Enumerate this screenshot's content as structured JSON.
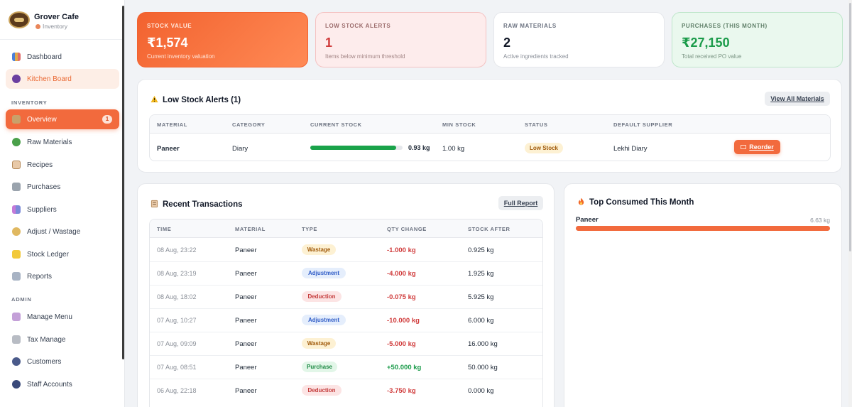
{
  "brand": {
    "name": "Grover Cafe",
    "subtitle": "Inventory"
  },
  "nav": {
    "dashboard": "Dashboard",
    "kitchen_board": "Kitchen Board",
    "section_inventory": "INVENTORY",
    "overview": "Overview",
    "overview_badge": "1",
    "raw_materials": "Raw Materials",
    "recipes": "Recipes",
    "purchases": "Purchases",
    "suppliers": "Suppliers",
    "adjust_wastage": "Adjust / Wastage",
    "stock_ledger": "Stock Ledger",
    "reports": "Reports",
    "section_admin": "ADMIN",
    "manage_menu": "Manage Menu",
    "tax_manage": "Tax Manage",
    "customers": "Customers",
    "staff_accounts": "Staff Accounts"
  },
  "stats": {
    "stock_value": {
      "title": "STOCK VALUE",
      "value": "₹1,574",
      "sub": "Current inventory valuation"
    },
    "low_stock": {
      "title": "LOW STOCK ALERTS",
      "value": "1",
      "sub": "Items below minimum threshold"
    },
    "raw_materials": {
      "title": "RAW MATERIALS",
      "value": "2",
      "sub": "Active ingredients tracked"
    },
    "purchases": {
      "title": "PURCHASES (THIS MONTH)",
      "value": "₹27,150",
      "sub": "Total received PO value"
    }
  },
  "low_stock_panel": {
    "title": "Low Stock Alerts (1)",
    "view_all": "View All Materials",
    "headers": [
      "MATERIAL",
      "CATEGORY",
      "CURRENT STOCK",
      "MIN STOCK",
      "STATUS",
      "DEFAULT SUPPLIER"
    ],
    "row": {
      "material": "Paneer",
      "category": "Diary",
      "current_stock": "0.93 kg",
      "stock_level": 0.93,
      "min_stock": "1.00 kg",
      "status": "Low Stock",
      "supplier": "Lekhi Diary",
      "action": "Reorder"
    }
  },
  "transactions": {
    "title": "Recent Transactions",
    "full_report": "Full Report",
    "headers": [
      "TIME",
      "MATERIAL",
      "TYPE",
      "QTY CHANGE",
      "STOCK AFTER"
    ],
    "rows": [
      {
        "time": "08 Aug, 23:22",
        "material": "Paneer",
        "type": "Wastage",
        "qty": "-1.000 kg",
        "after": "0.925 kg"
      },
      {
        "time": "08 Aug, 23:19",
        "material": "Paneer",
        "type": "Adjustment",
        "qty": "-4.000 kg",
        "after": "1.925 kg"
      },
      {
        "time": "08 Aug, 18:02",
        "material": "Paneer",
        "type": "Deduction",
        "qty": "-0.075 kg",
        "after": "5.925 kg"
      },
      {
        "time": "07 Aug, 10:27",
        "material": "Paneer",
        "type": "Adjustment",
        "qty": "-10.000 kg",
        "after": "6.000 kg"
      },
      {
        "time": "07 Aug, 09:09",
        "material": "Paneer",
        "type": "Wastage",
        "qty": "-5.000 kg",
        "after": "16.000 kg"
      },
      {
        "time": "07 Aug, 08:51",
        "material": "Paneer",
        "type": "Purchase",
        "qty": "+50.000 kg",
        "after": "50.000 kg"
      },
      {
        "time": "06 Aug, 22:18",
        "material": "Paneer",
        "type": "Deduction",
        "qty": "-3.750 kg",
        "after": "0.000 kg"
      }
    ]
  },
  "top_consumed": {
    "title": "Top Consumed This Month",
    "item": "Paneer",
    "amount": "6.63 kg",
    "fraction": 1.0
  },
  "colors": {
    "accent": "#f26a3d",
    "negative": "#d03b3b",
    "positive": "#1b9b4a",
    "stock_bar": "#1aa34a",
    "consumed_bar": "#f26a3d"
  }
}
